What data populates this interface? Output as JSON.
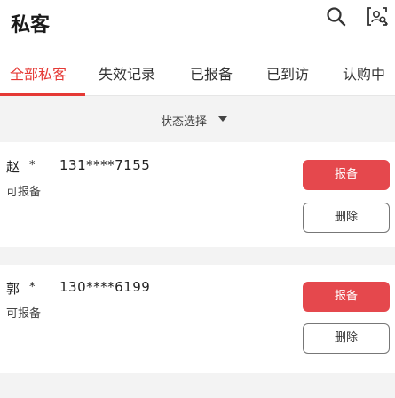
{
  "header": {
    "title": "私客",
    "icons": [
      "search-icon",
      "profile-search-icon"
    ]
  },
  "tabs": [
    {
      "label": "全部私客",
      "active": true
    },
    {
      "label": "失效记录",
      "active": false
    },
    {
      "label": "已报备",
      "active": false
    },
    {
      "label": "已到访",
      "active": false
    },
    {
      "label": "认购中",
      "active": false
    }
  ],
  "filter": {
    "label": "状态选择",
    "icon": "caret-down-icon"
  },
  "customers": [
    {
      "name": "赵",
      "name_mask": "*",
      "phone": "131****7155",
      "status": "可报备",
      "report_label": "报备",
      "delete_label": "删除"
    },
    {
      "name": "郭",
      "name_mask": "*",
      "phone": "130****6199",
      "status": "可报备",
      "report_label": "报备",
      "delete_label": "删除"
    }
  ],
  "colors": {
    "accent": "#e53935",
    "report_button": "#e5484d",
    "background": "#f3f3f3"
  }
}
